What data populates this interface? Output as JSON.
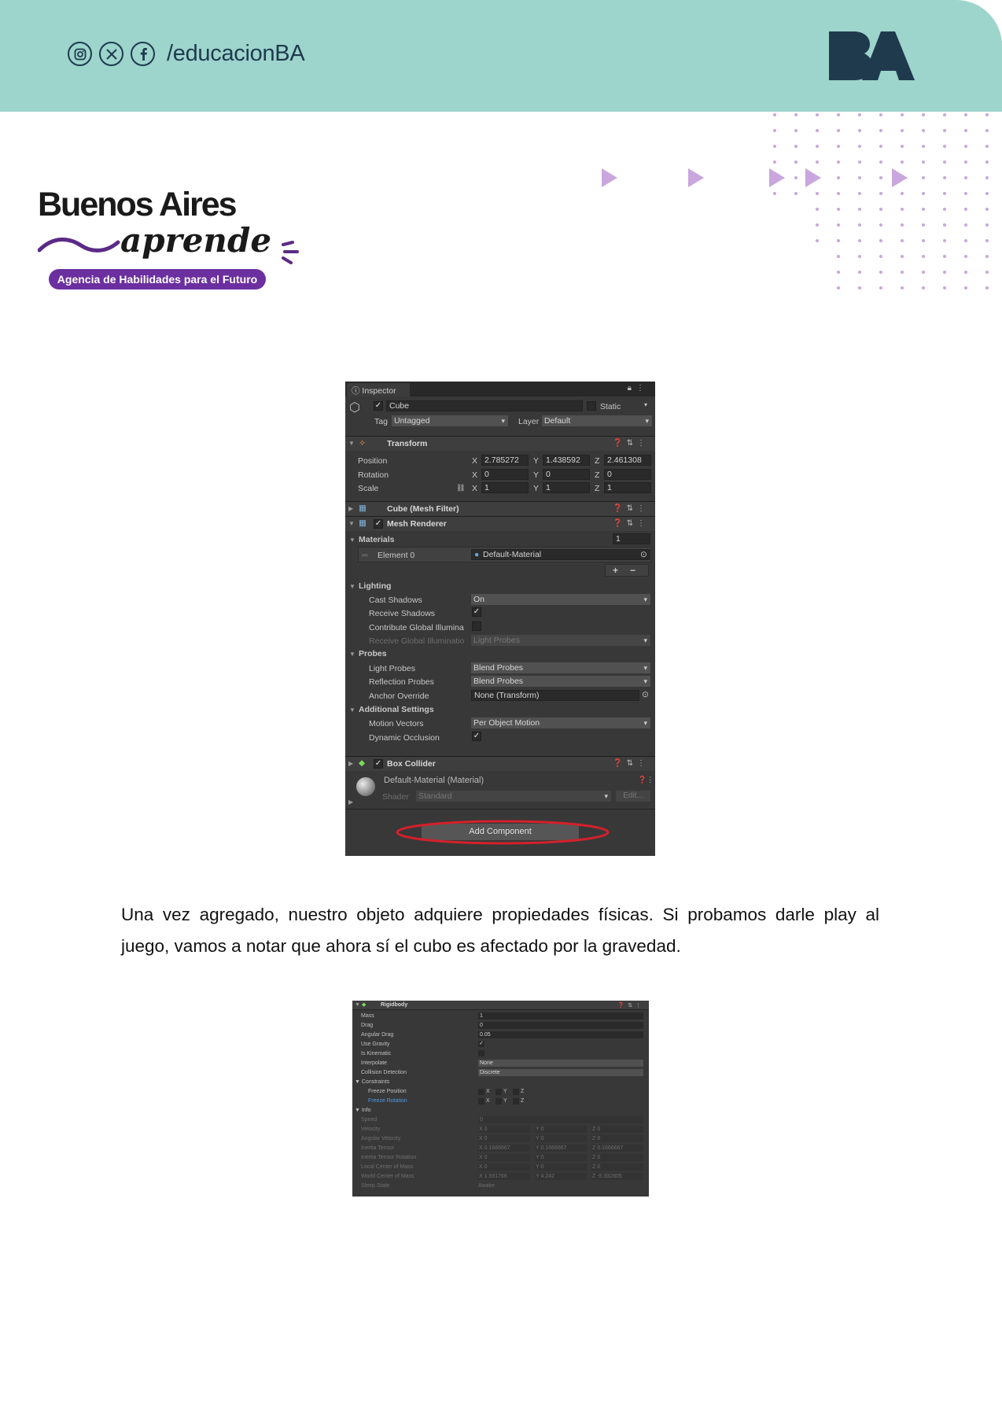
{
  "header": {
    "social_handle": "/educacionBA",
    "social_icons": [
      "instagram-icon",
      "x-icon",
      "facebook-icon"
    ],
    "brand_logo": "BA",
    "colors": {
      "band": "#9dd4cc",
      "navy": "#1f3a4d",
      "purple": "#6b2fa0",
      "dots": "#c9a6dd"
    }
  },
  "logo": {
    "line1": "Buenos Aires",
    "line2": "aprende",
    "tagline": "Agencia de Habilidades para el Futuro"
  },
  "inspector": {
    "tab": "Inspector",
    "object_name": "Cube",
    "static_label": "Static",
    "tag_label": "Tag",
    "tag_value": "Untagged",
    "layer_label": "Layer",
    "layer_value": "Default",
    "transform": {
      "title": "Transform",
      "position_label": "Position",
      "rotation_label": "Rotation",
      "scale_label": "Scale",
      "position": [
        "2.785272",
        "1.438592",
        "2.461308"
      ],
      "rotation": [
        "0",
        "0",
        "0"
      ],
      "scale": [
        "1",
        "1",
        "1"
      ]
    },
    "mesh_filter_title": "Cube (Mesh Filter)",
    "mesh_renderer": {
      "title": "Mesh Renderer",
      "materials_label": "Materials",
      "materials_count": "1",
      "element_label": "Element 0",
      "element_value": "Default-Material",
      "plus": "+",
      "minus": "−",
      "lighting": "Lighting",
      "cast_shadows_label": "Cast Shadows",
      "cast_shadows_value": "On",
      "receive_shadows_label": "Receive Shadows",
      "contribute_gi_label": "Contribute Global Illumina",
      "receive_gi_label": "Receive Global Illuminatio",
      "receive_gi_value": "Light Probes",
      "probes": "Probes",
      "light_probes_label": "Light Probes",
      "light_probes_value": "Blend Probes",
      "reflection_probes_label": "Reflection Probes",
      "reflection_probes_value": "Blend Probes",
      "anchor_override_label": "Anchor Override",
      "anchor_override_value": "None (Transform)",
      "additional": "Additional Settings",
      "motion_vectors_label": "Motion Vectors",
      "motion_vectors_value": "Per Object Motion",
      "dynamic_occlusion_label": "Dynamic Occlusion"
    },
    "box_collider_title": "Box Collider",
    "material": {
      "name": "Default-Material (Material)",
      "shader_label": "Shader",
      "shader_value": "Standard",
      "edit": "Edit..."
    },
    "add_component": "Add Component"
  },
  "paragraph": "Una vez agregado, nuestro objeto adquiere propiedades físicas. Si probamos darle play al juego, vamos a notar que ahora sí el cubo es afectado por la gravedad.",
  "rigidbody": {
    "title": "Rigidbody",
    "mass_label": "Mass",
    "mass": "1",
    "drag_label": "Drag",
    "drag": "0",
    "angular_drag_label": "Angular Drag",
    "angular_drag": "0.05",
    "use_gravity_label": "Use Gravity",
    "is_kinematic_label": "Is Kinematic",
    "interpolate_label": "Interpolate",
    "interpolate": "None",
    "collision_label": "Collision Detection",
    "collision": "Discrete",
    "constraints_label": "Constraints",
    "freeze_position_label": "Freeze Position",
    "freeze_rotation_label": "Freeze Rotation",
    "axes": [
      "X",
      "Y",
      "Z"
    ],
    "info_label": "Info",
    "speed_label": "Speed",
    "speed": "0",
    "info_rows": [
      {
        "label": "Velocity",
        "x": "0",
        "y": "0",
        "z": "0"
      },
      {
        "label": "Angular Velocity",
        "x": "0",
        "y": "0",
        "z": "0"
      },
      {
        "label": "Inertia Tensor",
        "x": "0.1666667",
        "y": "0.1666667",
        "z": "0.1666667"
      },
      {
        "label": "Inertia Tensor Rotation",
        "x": "0",
        "y": "0",
        "z": "0"
      },
      {
        "label": "Local Center of Mass",
        "x": "0",
        "y": "0",
        "z": "0"
      },
      {
        "label": "World Center of Mass",
        "x": "1.591766",
        "y": "4.242",
        "z": "-5.332805"
      }
    ],
    "sleep_label": "Sleep State",
    "sleep": "Awake"
  }
}
